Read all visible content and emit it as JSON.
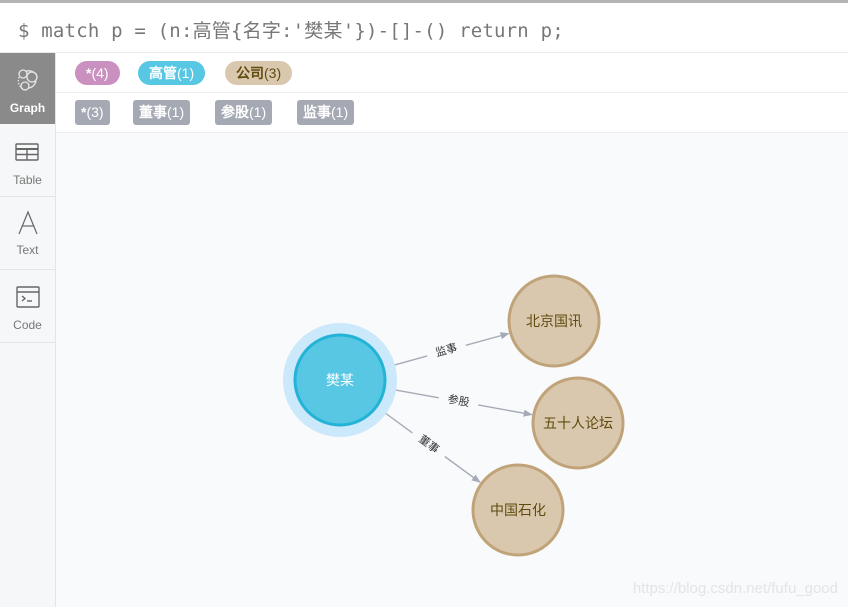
{
  "query": {
    "prompt": "$",
    "text": "match p = (n:高管{名字:'樊某'})-[]-() return p;"
  },
  "sidebar": {
    "items": [
      {
        "label": "Graph",
        "icon": "graph-icon",
        "active": true
      },
      {
        "label": "Table",
        "icon": "table-icon",
        "active": false
      },
      {
        "label": "Text",
        "icon": "text-icon",
        "active": false
      },
      {
        "label": "Code",
        "icon": "code-icon",
        "active": false
      }
    ]
  },
  "node_labels": [
    {
      "name": "*",
      "count": "(4)",
      "color": "#c990c0",
      "text_color": "#ffffff"
    },
    {
      "name": "高管",
      "count": "(1)",
      "color": "#57c7e3",
      "text_color": "#ffffff"
    },
    {
      "name": "公司",
      "count": "(3)",
      "color": "#d9c8ae",
      "text_color": "#604a0e"
    }
  ],
  "relationship_types": [
    {
      "name": "*",
      "count": "(3)"
    },
    {
      "name": "董事",
      "count": "(1)"
    },
    {
      "name": "参股",
      "count": "(1)"
    },
    {
      "name": "监事",
      "count": "(1)"
    }
  ],
  "graph": {
    "nodes": [
      {
        "id": "n0",
        "caption": "樊某",
        "label": "高管",
        "fill": "#57c7e3",
        "stroke": "#23b3d7",
        "text_color": "#ffffff",
        "selected": true
      },
      {
        "id": "n1",
        "caption": "北京国讯",
        "label": "公司",
        "fill": "#d9c8ae",
        "stroke": "#c0a378",
        "text_color": "#604a0e",
        "selected": false
      },
      {
        "id": "n2",
        "caption": "五十人论坛",
        "label": "公司",
        "fill": "#d9c8ae",
        "stroke": "#c0a378",
        "text_color": "#604a0e",
        "selected": false
      },
      {
        "id": "n3",
        "caption": "中国石化",
        "label": "公司",
        "fill": "#d9c8ae",
        "stroke": "#c0a378",
        "text_color": "#604a0e",
        "selected": false
      }
    ],
    "relationships": [
      {
        "source": "n0",
        "target": "n1",
        "type": "监事"
      },
      {
        "source": "n0",
        "target": "n2",
        "type": "参股"
      },
      {
        "source": "n0",
        "target": "n3",
        "type": "董事"
      }
    ],
    "edge_color": "#a5abb6",
    "halo_color": "#cbe9fa"
  },
  "watermark": "https://blog.csdn.net/fufu_good"
}
